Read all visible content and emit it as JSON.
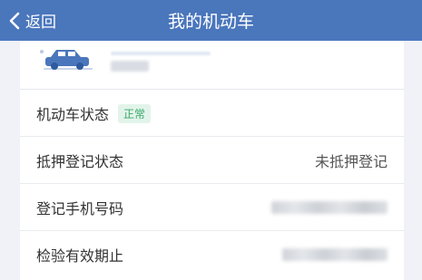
{
  "navbar": {
    "back_label": "返回",
    "title": "我的机动车",
    "background": "#4a76bc"
  },
  "vehicle": {
    "icon": "car-icon",
    "accent": "#4a76bc"
  },
  "rows": [
    {
      "label": "机动车状态",
      "badge": "正常",
      "badge_color": "#3aa86b"
    },
    {
      "label": "抵押登记状态",
      "value": "未抵押登记"
    },
    {
      "label": "登记手机号码",
      "masked": true
    },
    {
      "label": "检验有效期止",
      "masked": true
    }
  ]
}
